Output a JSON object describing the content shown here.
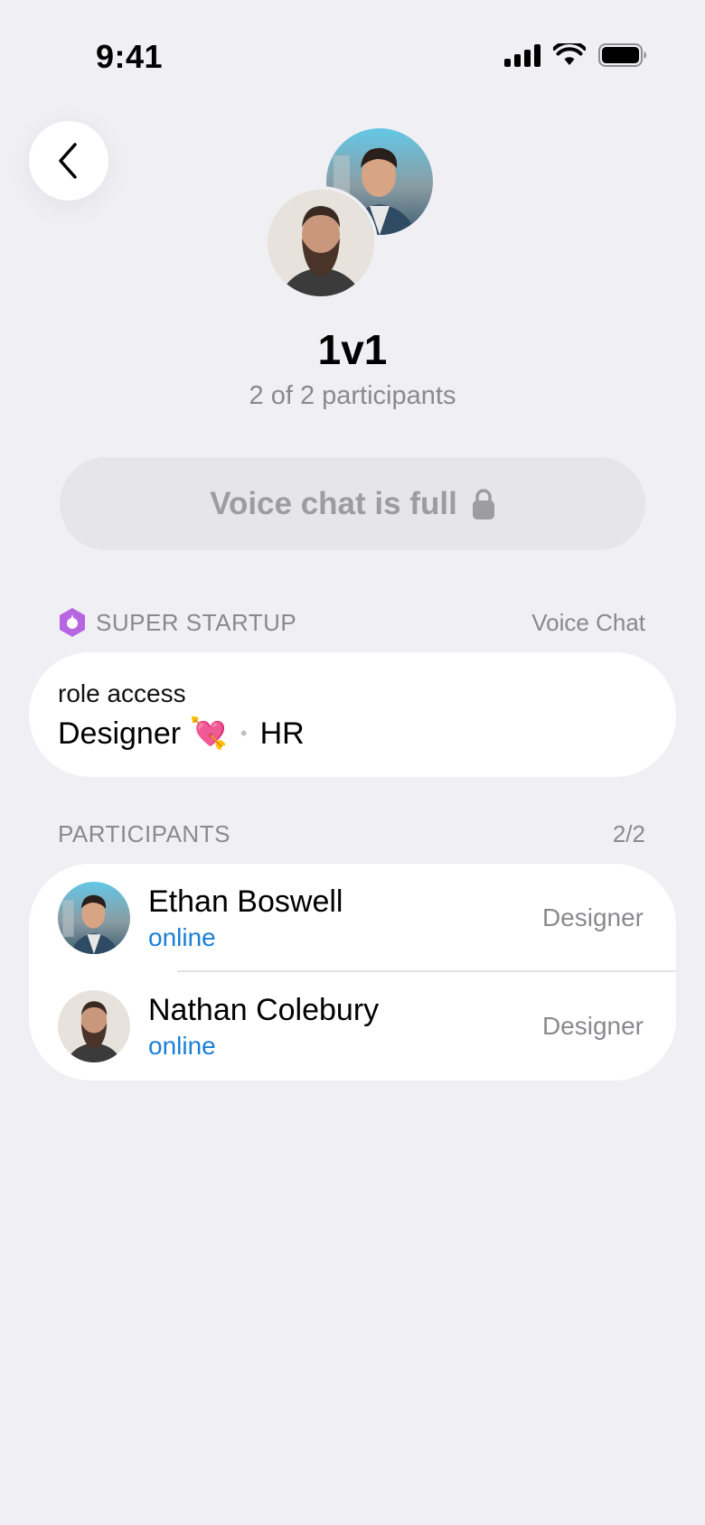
{
  "status_bar": {
    "time": "9:41"
  },
  "header": {
    "title": "1v1",
    "subtitle": "2 of 2 participants"
  },
  "join_button": {
    "label": "Voice chat is full"
  },
  "org": {
    "name": "SUPER STARTUP",
    "type_label": "Voice Chat",
    "accent_color": "#b765e0"
  },
  "role_access": {
    "label": "role access",
    "roles": [
      "Designer 💘",
      "HR"
    ]
  },
  "participants": {
    "header": "PARTICIPANTS",
    "count": "2/2",
    "items": [
      {
        "name": "Ethan Boswell",
        "status": "online",
        "role": "Designer"
      },
      {
        "name": "Nathan Colebury",
        "status": "online",
        "role": "Designer"
      }
    ]
  },
  "colors": {
    "background": "#efeff4",
    "online": "#1a7fd6",
    "muted": "#8a8a8e"
  }
}
